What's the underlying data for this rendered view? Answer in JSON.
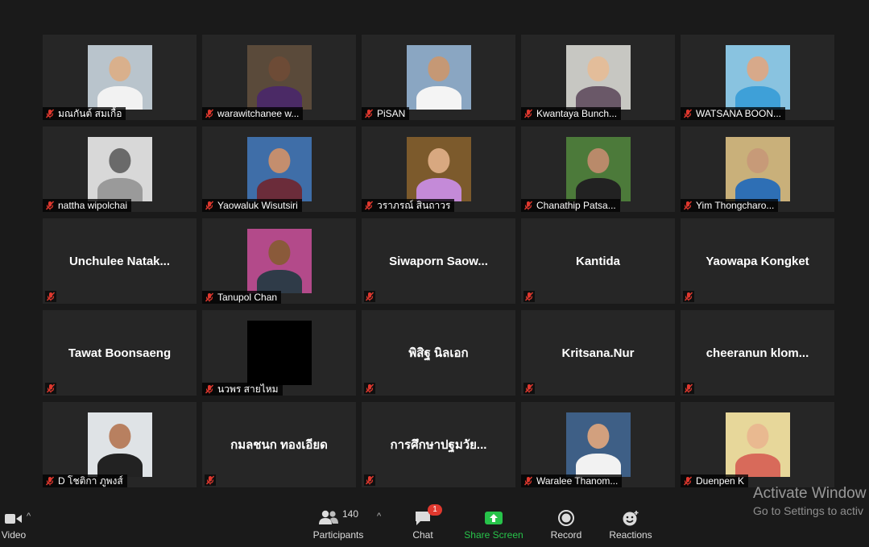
{
  "participants": [
    {
      "name": "มณกันต์ สมเกื้อ",
      "video": true
    },
    {
      "name": "warawitchanee w...",
      "video": true
    },
    {
      "name": "PiSAN",
      "video": true
    },
    {
      "name": "Kwantaya Bunch...",
      "video": true
    },
    {
      "name": "WATSANA BOON...",
      "video": true
    },
    {
      "name": "nattha wipolchai",
      "video": true
    },
    {
      "name": "Yaowaluk Wisutsiri",
      "video": true
    },
    {
      "name": "วราภรณ์ สินถาวร",
      "video": true
    },
    {
      "name": "Chanathip Patsa...",
      "video": true
    },
    {
      "name": "Yim Thongcharo...",
      "video": true
    },
    {
      "name": "Unchulee  Natak...",
      "video": false
    },
    {
      "name": "Tanupol Chan",
      "video": true
    },
    {
      "name": "Siwaporn  Saow...",
      "video": false
    },
    {
      "name": "Kantida",
      "video": false
    },
    {
      "name": "Yaowapa Kongket",
      "video": false
    },
    {
      "name": "Tawat Boonsaeng",
      "video": false
    },
    {
      "name": "นวพร สายไหม",
      "video": true
    },
    {
      "name": "พิสิฐ นิลเอก",
      "video": false
    },
    {
      "name": "Kritsana.Nur",
      "video": false
    },
    {
      "name": "cheeranun  klom...",
      "video": false
    },
    {
      "name": "D โชติกา ภูพงส์",
      "video": true
    },
    {
      "name": "กมลชนก ทองเอียด",
      "video": false
    },
    {
      "name": "การศึกษาปฐมวัย...",
      "video": false
    },
    {
      "name": "Waralee Thanom...",
      "video": true
    },
    {
      "name": "Duenpen K",
      "video": true
    }
  ],
  "toolbar": {
    "video_label": "Video",
    "participants_label": "Participants",
    "participants_count": "140",
    "chat_label": "Chat",
    "chat_badge": "1",
    "share_label": "Share Screen",
    "record_label": "Record",
    "reactions_label": "Reactions"
  },
  "watermark": {
    "line1": "Activate Window",
    "line2": "Go to Settings to activ"
  },
  "colors": {
    "background": "#1a1a1a",
    "tile": "#262626",
    "share_green": "#27c34a",
    "muted_red": "#e0382e",
    "badge_red": "#e0382e"
  }
}
